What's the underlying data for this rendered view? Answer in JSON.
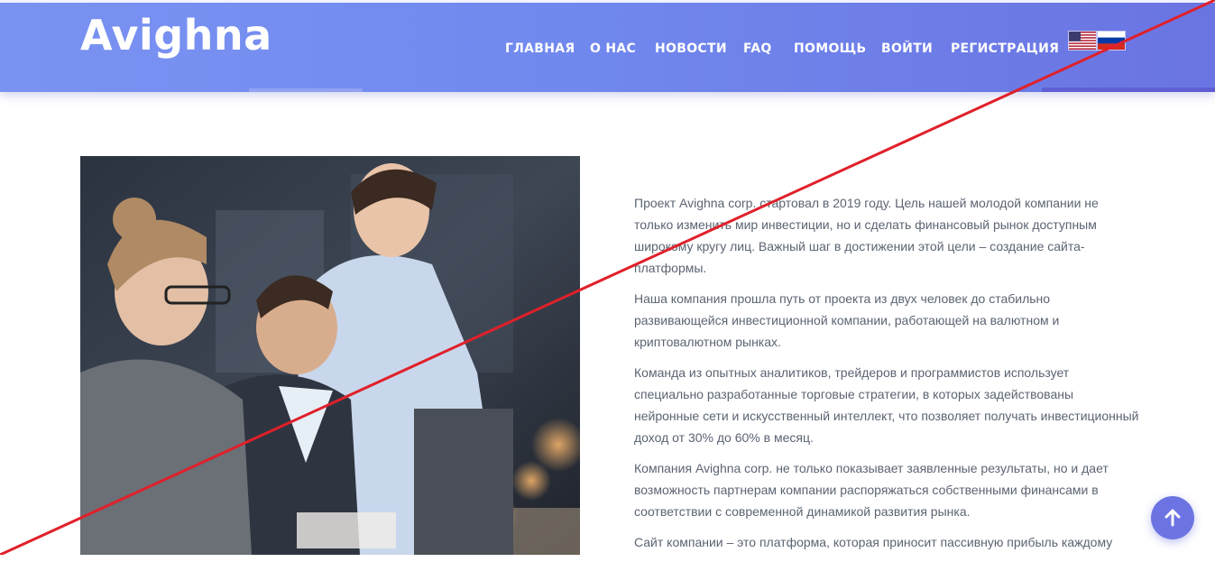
{
  "header": {
    "logo": "Avighna",
    "nav": [
      {
        "label": "ГЛАВНАЯ"
      },
      {
        "label": "О НАС"
      },
      {
        "label": "НОВОСТИ"
      },
      {
        "label": "FAQ"
      },
      {
        "label": "ПОМОЩЬ"
      },
      {
        "label": "ВОЙТИ"
      },
      {
        "label": "РЕГИСТРАЦИЯ"
      }
    ],
    "languages": [
      "us-flag-icon",
      "ru-flag-icon"
    ]
  },
  "main": {
    "paragraphs": [
      "Проект Avighna corp. стартовал в 2019 году. Цель нашей молодой компании не только изменить мир инвестиции, но и сделать финансовый рынок доступным широкому кругу лиц. Важный шаг в достижении этой цели – создание сайта-платформы.",
      "Наша компания прошла путь от проекта из двух человек до стабильно развивающейся инвестиционной компании, работающей на валютном и криптовалютном рынках.",
      "Команда из опытных аналитиков, трейдеров и программистов использует специально разработанные торговые стратегии, в которых задействованы нейронные сети и искусственный интеллект, что позволяет получать инвестиционный доход от 30% до 60% в месяц.",
      "Компания Avighna corp. не только показывает заявленные результаты, но и дает возможность партнерам компании распоряжаться собственными финансами в соответствии с современной динамикой развития рынка.",
      "Сайт компании – это платформа, которая приносит пассивную прибыль каждому"
    ]
  },
  "colors": {
    "header_start": "#7a93f2",
    "header_end": "#6a74e2",
    "text": "#5b6472",
    "scroll_button": "#6c74e3",
    "strike_line": "#e0202a"
  },
  "icons": {
    "scroll_top": "arrow-up-icon"
  }
}
